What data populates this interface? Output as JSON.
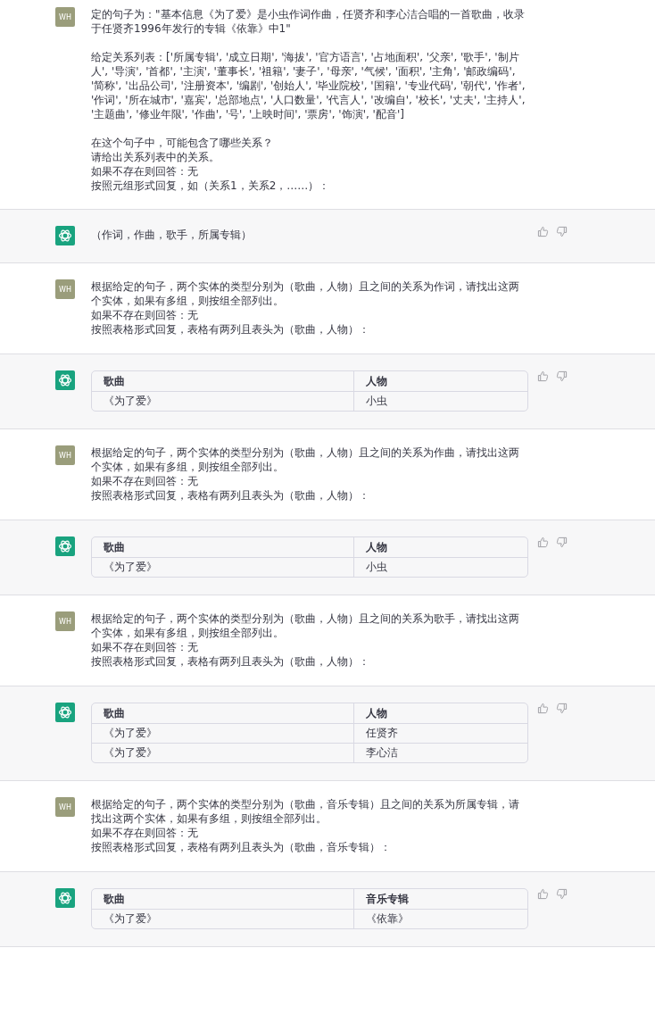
{
  "messages": [
    {
      "kind": "user",
      "avatar": "WH",
      "blocks": [
        [
          "定的句子为：\"基本信息《为了爱》是小虫作词作曲，任贤齐和李心洁合唱的一首歌曲，收录于任贤齐1996年发行的专辑《依靠》中1\""
        ],
        [
          "给定关系列表：['所属专辑', '成立日期', '海拔', '官方语言', '占地面积', '父亲', '歌手', '制片人', '导演', '首都', '主演', '董事长', '祖籍', '妻子', '母亲', '气候', '面积', '主角', '邮政编码', '简称', '出品公司', '注册资本', '编剧', '创始人', '毕业院校', '国籍', '专业代码', '朝代', '作者', '作词', '所在城市', '嘉宾', '总部地点', '人口数量', '代言人', '改编自', '校长', '丈夫', '主持人', '主题曲', '修业年限', '作曲', '号', '上映时间', '票房', '饰演', '配音']"
        ],
        [
          "在这个句子中，可能包含了哪些关系？",
          "请给出关系列表中的关系。",
          "如果不存在则回答：无",
          "按照元组形式回复，如（关系1，关系2，……）："
        ]
      ]
    },
    {
      "kind": "assistant",
      "text": "（作词，作曲，歌手，所属专辑）"
    },
    {
      "kind": "user",
      "avatar": "WH",
      "blocks": [
        [
          "根据给定的句子，两个实体的类型分别为（歌曲，人物）且之间的关系为作词，请找出这两个实体，如果有多组，则按组全部列出。",
          "如果不存在则回答：无",
          "按照表格形式回复，表格有两列且表头为（歌曲，人物）："
        ]
      ]
    },
    {
      "kind": "assistant",
      "table": {
        "columns": [
          "歌曲",
          "人物"
        ],
        "rows": [
          [
            "《为了爱》",
            "小虫"
          ]
        ]
      }
    },
    {
      "kind": "user",
      "avatar": "WH",
      "blocks": [
        [
          "根据给定的句子，两个实体的类型分别为（歌曲，人物）且之间的关系为作曲，请找出这两个实体，如果有多组，则按组全部列出。",
          "如果不存在则回答：无",
          "按照表格形式回复，表格有两列且表头为（歌曲，人物）："
        ]
      ]
    },
    {
      "kind": "assistant",
      "table": {
        "columns": [
          "歌曲",
          "人物"
        ],
        "rows": [
          [
            "《为了爱》",
            "小虫"
          ]
        ]
      }
    },
    {
      "kind": "user",
      "avatar": "WH",
      "blocks": [
        [
          "根据给定的句子，两个实体的类型分别为（歌曲，人物）且之间的关系为歌手，请找出这两个实体，如果有多组，则按组全部列出。",
          "如果不存在则回答：无",
          "按照表格形式回复，表格有两列且表头为（歌曲，人物）："
        ]
      ]
    },
    {
      "kind": "assistant",
      "table": {
        "columns": [
          "歌曲",
          "人物"
        ],
        "rows": [
          [
            "《为了爱》",
            "任贤齐"
          ],
          [
            "《为了爱》",
            "李心洁"
          ]
        ]
      }
    },
    {
      "kind": "user",
      "avatar": "WH",
      "blocks": [
        [
          "根据给定的句子，两个实体的类型分别为（歌曲，音乐专辑）且之间的关系为所属专辑，请找出这两个实体，如果有多组，则按组全部列出。",
          "如果不存在则回答：无",
          "按照表格形式回复，表格有两列且表头为（歌曲，音乐专辑）："
        ]
      ]
    },
    {
      "kind": "assistant",
      "table": {
        "columns": [
          "歌曲",
          "音乐专辑"
        ],
        "rows": [
          [
            "《为了爱》",
            "《依靠》"
          ]
        ]
      }
    }
  ]
}
